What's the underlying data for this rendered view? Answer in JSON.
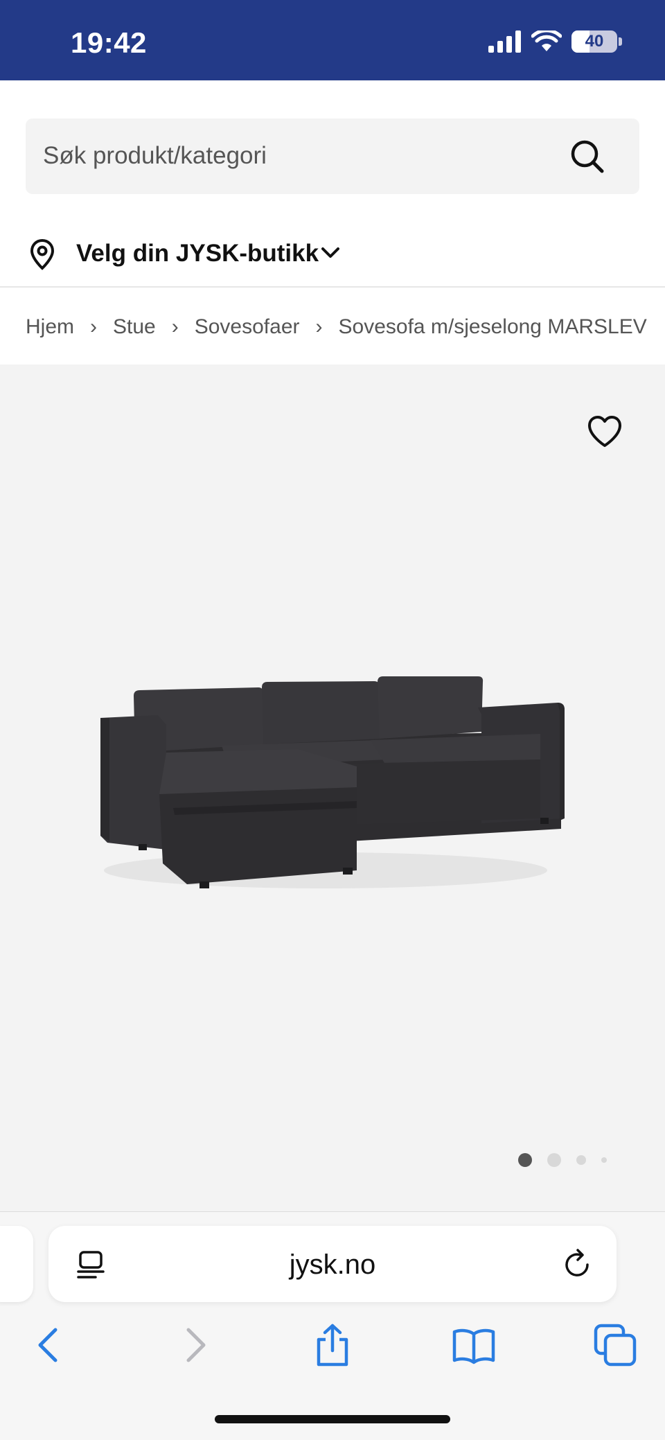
{
  "status_bar": {
    "time": "19:42",
    "battery_level": "40",
    "background_color": "#233a88"
  },
  "search": {
    "placeholder": "Søk produkt/kategori",
    "icon": "search-icon"
  },
  "store_selector": {
    "label": "Velg din JYSK-butikk",
    "icon": "location-pin-icon"
  },
  "breadcrumb": {
    "items": [
      "Hjem",
      "Stue",
      "Sovesofaer",
      "Sovesofa m/sjeselong MARSLEV"
    ],
    "separator": "›"
  },
  "gallery": {
    "image": "dark grey corner sleeper sofa with chaise",
    "image_count": 4,
    "active_index": 0,
    "favorite_icon": "heart-icon"
  },
  "browser": {
    "url": "jysk.no",
    "accent_color": "#2a7de1"
  }
}
